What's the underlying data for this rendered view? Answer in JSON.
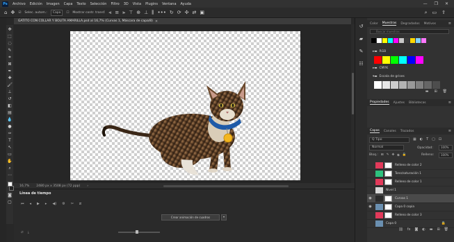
{
  "menubar": {
    "logo": "Ps",
    "items": [
      "Archivo",
      "Edición",
      "Imagen",
      "Capa",
      "Texto",
      "Selección",
      "Filtro",
      "3D",
      "Vista",
      "Plugins",
      "Ventana",
      "Ayuda"
    ]
  },
  "options": {
    "auto_select_label": "Selec. autom.:",
    "auto_select_value": "Capa",
    "transform_controls": "Mostrar contr. transf."
  },
  "document": {
    "tab_title": "GATITO CON COLLAR Y BOLITA AMARILLA.psd al 16,7% (Curvas 1, Máscara de capa/8)",
    "close": "×",
    "zoom": "16,7%",
    "doc_info": "2480 px x 3508 px (72 ppp)"
  },
  "timeline": {
    "title": "Línea de tiempo",
    "create_button": "Crear animación de cuadros",
    "dropdown": "▾"
  },
  "swatches_panel": {
    "tabs": [
      "Color",
      "Muestras",
      "Degradados",
      "Motivos"
    ],
    "active_tab": "Muestras",
    "search_placeholder": "Buscar muestras",
    "groups": [
      "RGB",
      "CMYK",
      "Escala de grises"
    ],
    "recent_colors": [
      "#000000",
      "#ffffff",
      "#ffff00",
      "#00ffff",
      "#ff00ff",
      "#c8c8c8",
      "#3a3a3a",
      "#ffd800",
      "#7fd3ff",
      "#ff77ff"
    ],
    "rgb_colors": [
      "#ff0000",
      "#ffff00",
      "#00ff00",
      "#00ffff",
      "#0000ff",
      "#ff00ff"
    ],
    "cmyk_colors": [
      "#00a0e9",
      "#e4007f",
      "#fff100",
      "#000000"
    ],
    "gray_colors": [
      "#ffffff",
      "#e6e6e6",
      "#cccccc",
      "#b3b3b3",
      "#999999",
      "#808080",
      "#666666",
      "#4d4d4d"
    ]
  },
  "properties_tabs": [
    "Propiedades",
    "Ajustes",
    "Bibliotecas"
  ],
  "layers_panel": {
    "tabs": [
      "Capas",
      "Canales",
      "Trazados"
    ],
    "active_tab": "Capas",
    "filter": "Q Tipo",
    "blend_mode": "Normal",
    "opacity_label": "Opacidad:",
    "opacity_value": "100%",
    "lock_label": "Bloq.:",
    "fill_label": "Relleno:",
    "fill_value": "100%",
    "layers": [
      {
        "name": "Relleno de color 2",
        "visible": false,
        "thumb": "#e23a5a",
        "has_mask": true,
        "selected": false
      },
      {
        "name": "Tono/saturación 1",
        "visible": false,
        "thumb": "#2ec27e",
        "has_mask": true,
        "selected": false
      },
      {
        "name": "Relleno de color 1",
        "visible": false,
        "thumb": "#e23a5a",
        "has_mask": true,
        "selected": false
      },
      {
        "name": "Nivel 1",
        "visible": false,
        "thumb": "#d9d9d9",
        "has_mask": false,
        "selected": false
      },
      {
        "name": "Curvas 1",
        "visible": true,
        "thumb": "#2b2b2b",
        "has_mask": true,
        "selected": true
      },
      {
        "name": "Capa 0 copia",
        "visible": true,
        "thumb": "#6a8fb0",
        "has_mask": true,
        "selected": false
      },
      {
        "name": "Relleno de color 3",
        "visible": false,
        "thumb": "#e23a5a",
        "has_mask": true,
        "selected": false
      },
      {
        "name": "Capa 0",
        "visible": false,
        "thumb": "#6a8fb0",
        "has_mask": false,
        "selected": false,
        "locked": true
      }
    ]
  }
}
